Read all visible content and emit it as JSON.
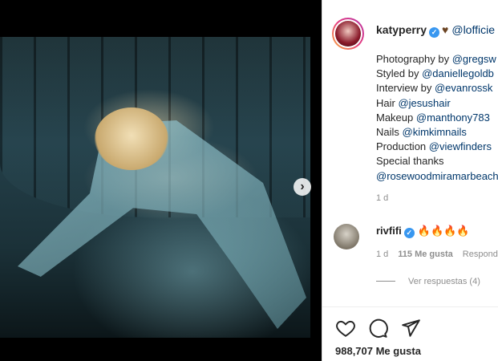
{
  "post": {
    "username": "katyperry",
    "header_mention": "@lofficie",
    "caption_lines": [
      {
        "label": "Photography by ",
        "mention": "@gregsw"
      },
      {
        "label": "Styled by ",
        "mention": "@daniellegoldb"
      },
      {
        "label": "Interview by ",
        "mention": "@evanrossk"
      },
      {
        "label": "Hair ",
        "mention": "@jesushair"
      },
      {
        "label": "Makeup ",
        "mention": "@manthony783"
      },
      {
        "label": "Nails ",
        "mention": "@kimkimnails"
      },
      {
        "label": "Production ",
        "mention": "@viewfinders"
      },
      {
        "label": "Special thanks",
        "mention": ""
      },
      {
        "label": "",
        "mention": "@rosewoodmiramarbeach"
      }
    ],
    "time": "1 d"
  },
  "comment": {
    "username": "rivfifi",
    "text": "🔥🔥🔥🔥",
    "time": "1 d",
    "likes": "115 Me gusta",
    "reply": "Respond",
    "view_replies": "Ver respuestas (4)"
  },
  "footer": {
    "likes": "988,707 Me gusta"
  },
  "icons": {
    "verified": "verified-badge-icon",
    "heart": "brown-heart-icon",
    "next": "chevron-right-icon",
    "like": "heart-outline-icon",
    "comment": "comment-bubble-icon",
    "share": "paper-plane-icon"
  },
  "colors": {
    "mention": "#00376b",
    "verified": "#3897f0",
    "muted": "#8e8e8e"
  }
}
